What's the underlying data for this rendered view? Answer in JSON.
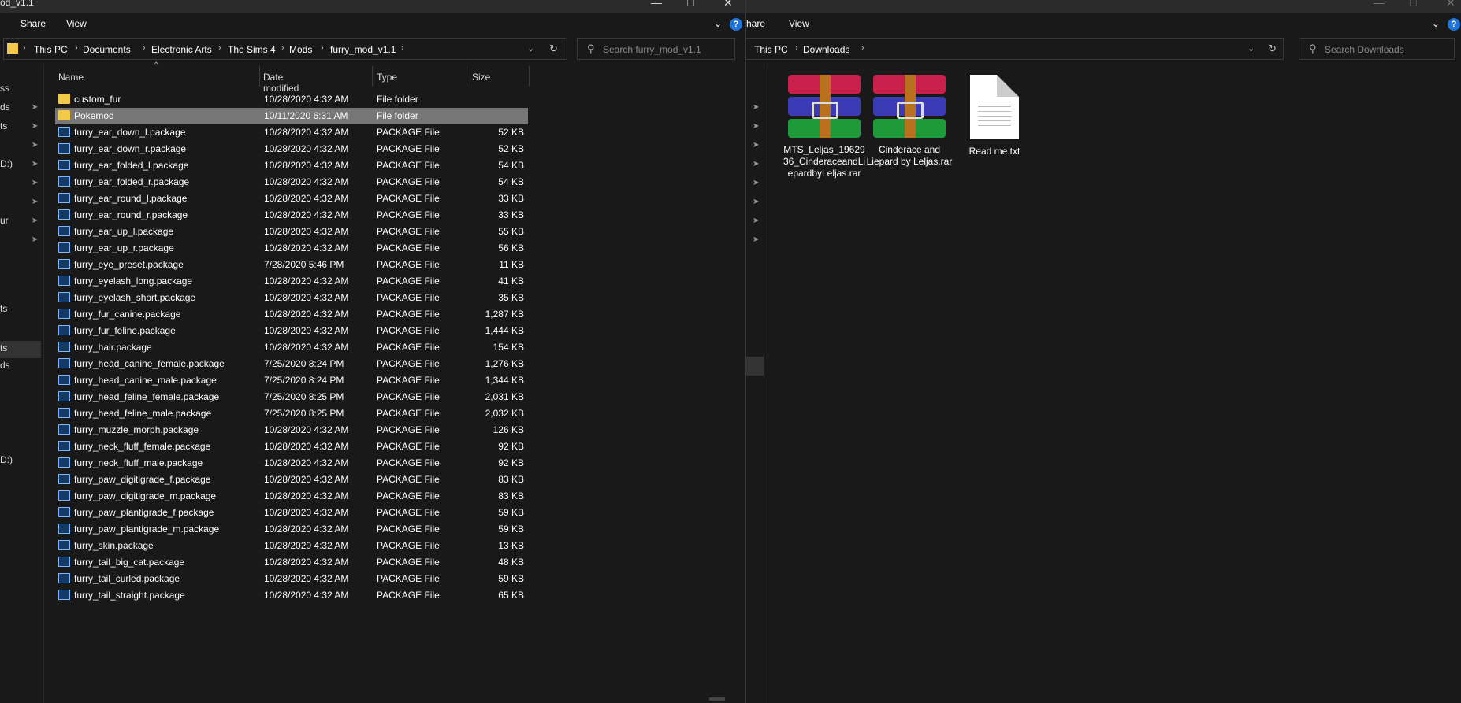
{
  "left": {
    "title": "od_v1.1",
    "ribbon": {
      "share": "Share",
      "view": "View",
      "help": "?"
    },
    "path": [
      "This PC",
      "Documents",
      "Electronic Arts",
      "The Sims 4",
      "Mods",
      "furry_mod_v1.1"
    ],
    "search_placeholder": "Search furry_mod_v1.1",
    "nav": [
      "ss",
      "ds",
      "ts",
      "D:)",
      "ur",
      "ts",
      "ts",
      "ds",
      "D:)"
    ],
    "columns": {
      "name": "Name",
      "date": "Date modified",
      "type": "Type",
      "size": "Size"
    },
    "files": [
      {
        "name": "custom_fur",
        "date": "10/28/2020 4:32 AM",
        "type": "File folder",
        "size": "",
        "icon": "folder-icon"
      },
      {
        "name": "Pokemod",
        "date": "10/11/2020 6:31 AM",
        "type": "File folder",
        "size": "",
        "icon": "folder-icon",
        "selected": true
      },
      {
        "name": "furry_ear_down_l.package",
        "date": "10/28/2020 4:32 AM",
        "type": "PACKAGE File",
        "size": "52 KB",
        "icon": "package-file-icon"
      },
      {
        "name": "furry_ear_down_r.package",
        "date": "10/28/2020 4:32 AM",
        "type": "PACKAGE File",
        "size": "52 KB",
        "icon": "package-file-icon"
      },
      {
        "name": "furry_ear_folded_l.package",
        "date": "10/28/2020 4:32 AM",
        "type": "PACKAGE File",
        "size": "54 KB",
        "icon": "package-file-icon"
      },
      {
        "name": "furry_ear_folded_r.package",
        "date": "10/28/2020 4:32 AM",
        "type": "PACKAGE File",
        "size": "54 KB",
        "icon": "package-file-icon"
      },
      {
        "name": "furry_ear_round_l.package",
        "date": "10/28/2020 4:32 AM",
        "type": "PACKAGE File",
        "size": "33 KB",
        "icon": "package-file-icon"
      },
      {
        "name": "furry_ear_round_r.package",
        "date": "10/28/2020 4:32 AM",
        "type": "PACKAGE File",
        "size": "33 KB",
        "icon": "package-file-icon"
      },
      {
        "name": "furry_ear_up_l.package",
        "date": "10/28/2020 4:32 AM",
        "type": "PACKAGE File",
        "size": "55 KB",
        "icon": "package-file-icon"
      },
      {
        "name": "furry_ear_up_r.package",
        "date": "10/28/2020 4:32 AM",
        "type": "PACKAGE File",
        "size": "56 KB",
        "icon": "package-file-icon"
      },
      {
        "name": "furry_eye_preset.package",
        "date": "7/28/2020 5:46 PM",
        "type": "PACKAGE File",
        "size": "11 KB",
        "icon": "package-file-icon"
      },
      {
        "name": "furry_eyelash_long.package",
        "date": "10/28/2020 4:32 AM",
        "type": "PACKAGE File",
        "size": "41 KB",
        "icon": "package-file-icon"
      },
      {
        "name": "furry_eyelash_short.package",
        "date": "10/28/2020 4:32 AM",
        "type": "PACKAGE File",
        "size": "35 KB",
        "icon": "package-file-icon"
      },
      {
        "name": "furry_fur_canine.package",
        "date": "10/28/2020 4:32 AM",
        "type": "PACKAGE File",
        "size": "1,287 KB",
        "icon": "package-file-icon"
      },
      {
        "name": "furry_fur_feline.package",
        "date": "10/28/2020 4:32 AM",
        "type": "PACKAGE File",
        "size": "1,444 KB",
        "icon": "package-file-icon"
      },
      {
        "name": "furry_hair.package",
        "date": "10/28/2020 4:32 AM",
        "type": "PACKAGE File",
        "size": "154 KB",
        "icon": "package-file-icon"
      },
      {
        "name": "furry_head_canine_female.package",
        "date": "7/25/2020 8:24 PM",
        "type": "PACKAGE File",
        "size": "1,276 KB",
        "icon": "package-file-icon"
      },
      {
        "name": "furry_head_canine_male.package",
        "date": "7/25/2020 8:24 PM",
        "type": "PACKAGE File",
        "size": "1,344 KB",
        "icon": "package-file-icon"
      },
      {
        "name": "furry_head_feline_female.package",
        "date": "7/25/2020 8:25 PM",
        "type": "PACKAGE File",
        "size": "2,031 KB",
        "icon": "package-file-icon"
      },
      {
        "name": "furry_head_feline_male.package",
        "date": "7/25/2020 8:25 PM",
        "type": "PACKAGE File",
        "size": "2,032 KB",
        "icon": "package-file-icon"
      },
      {
        "name": "furry_muzzle_morph.package",
        "date": "10/28/2020 4:32 AM",
        "type": "PACKAGE File",
        "size": "126 KB",
        "icon": "package-file-icon"
      },
      {
        "name": "furry_neck_fluff_female.package",
        "date": "10/28/2020 4:32 AM",
        "type": "PACKAGE File",
        "size": "92 KB",
        "icon": "package-file-icon"
      },
      {
        "name": "furry_neck_fluff_male.package",
        "date": "10/28/2020 4:32 AM",
        "type": "PACKAGE File",
        "size": "92 KB",
        "icon": "package-file-icon"
      },
      {
        "name": "furry_paw_digitigrade_f.package",
        "date": "10/28/2020 4:32 AM",
        "type": "PACKAGE File",
        "size": "83 KB",
        "icon": "package-file-icon"
      },
      {
        "name": "furry_paw_digitigrade_m.package",
        "date": "10/28/2020 4:32 AM",
        "type": "PACKAGE File",
        "size": "83 KB",
        "icon": "package-file-icon"
      },
      {
        "name": "furry_paw_plantigrade_f.package",
        "date": "10/28/2020 4:32 AM",
        "type": "PACKAGE File",
        "size": "59 KB",
        "icon": "package-file-icon"
      },
      {
        "name": "furry_paw_plantigrade_m.package",
        "date": "10/28/2020 4:32 AM",
        "type": "PACKAGE File",
        "size": "59 KB",
        "icon": "package-file-icon"
      },
      {
        "name": "furry_skin.package",
        "date": "10/28/2020 4:32 AM",
        "type": "PACKAGE File",
        "size": "13 KB",
        "icon": "package-file-icon"
      },
      {
        "name": "furry_tail_big_cat.package",
        "date": "10/28/2020 4:32 AM",
        "type": "PACKAGE File",
        "size": "48 KB",
        "icon": "package-file-icon"
      },
      {
        "name": "furry_tail_curled.package",
        "date": "10/28/2020 4:32 AM",
        "type": "PACKAGE File",
        "size": "59 KB",
        "icon": "package-file-icon"
      },
      {
        "name": "furry_tail_straight.package",
        "date": "10/28/2020 4:32 AM",
        "type": "PACKAGE File",
        "size": "65 KB",
        "icon": "package-file-icon"
      }
    ]
  },
  "right": {
    "ribbon": {
      "share": "hare",
      "view": "View",
      "help": "?"
    },
    "path": [
      "This PC",
      "Downloads"
    ],
    "search_placeholder": "Search Downloads",
    "items": [
      {
        "label": "MTS_Leljas_1962936_CinderaceandLiepardbyLeljas.rar",
        "icon": "winrar-archive-icon"
      },
      {
        "label": "Cinderace and Liepard by Leljas.rar",
        "icon": "winrar-archive-icon"
      },
      {
        "label": "Read me.txt",
        "icon": "text-file-icon"
      }
    ]
  },
  "colors": {
    "background": "#191919",
    "selected_row": "#777777",
    "folder": "#f2c94c",
    "help_blue": "#1e74d8"
  }
}
